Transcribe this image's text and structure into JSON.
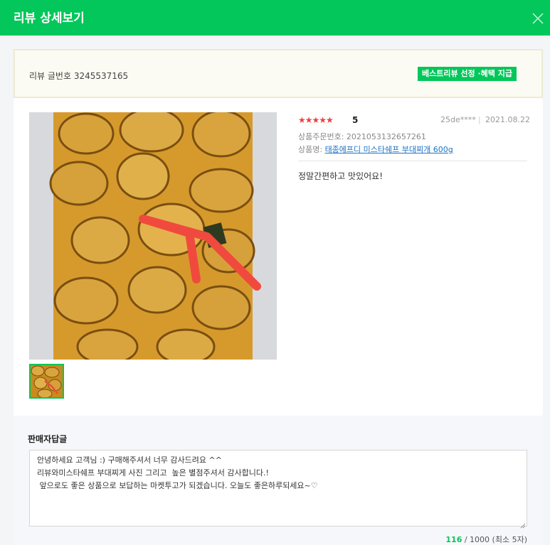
{
  "header": {
    "title": "리뷰 상세보기",
    "close_icon": "close-icon"
  },
  "meta": {
    "review_number_label": "리뷰 글번호 3245537165",
    "badge": "베스트리뷰 선정 ·혜택 지급"
  },
  "review": {
    "stars": "★★★★★",
    "rating_value": 5,
    "rating": "5",
    "writer": "25de****",
    "separator": "|",
    "date": "2021.08.22",
    "order_number": "상품주문번호: 2021053132657261",
    "product_label": "상품명: ",
    "product_name": "태종에프디 미스타쉐프 부대찌개 600g",
    "text": "정말간편하고 맛있어요!",
    "photo_icon": "food-photo",
    "thumbnail_icon": "food-photo-thumbnail"
  },
  "reply": {
    "title": "판매자답글",
    "content": "안녕하세요 고객님 :) 구매해주셔서 너무 감사드려요 ^^\n리뷰와미스타쉐프 부대찌게 사진 그리고  높은 별점주셔서 감사합니다.!\n 앞으로도 좋은 상품으로 보답하는 마켓투고가 되겠습니다. 오늘도 좋은하루되세요~♡",
    "char_count": "116",
    "char_limit": " / 1000 (최소 5자)"
  },
  "colors": {
    "accent": "#03c75a",
    "star": "#f03e3e",
    "link": "#1a73c8"
  }
}
